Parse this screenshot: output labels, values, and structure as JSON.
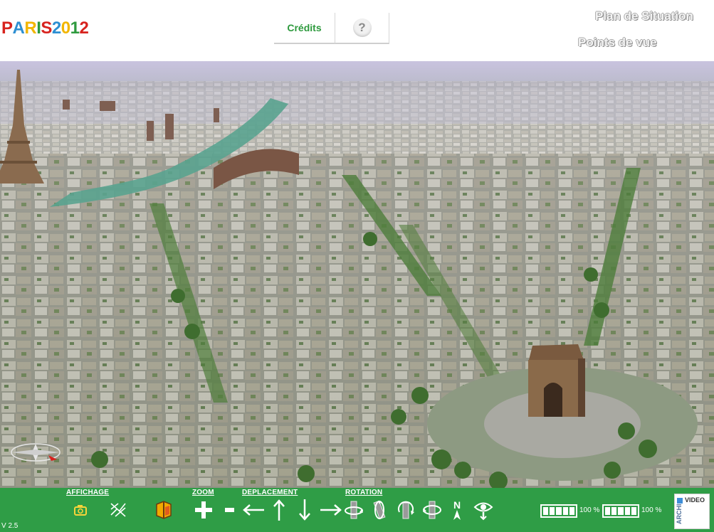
{
  "header": {
    "logo_text": "PARIS2012",
    "tabs": [
      {
        "label": "Crédits"
      },
      {
        "label": "?"
      }
    ],
    "links": {
      "plan": "Plan de Situation",
      "points": "Points de vue"
    }
  },
  "toolbar": {
    "sections": {
      "affichage": "AFFICHAGE",
      "zoom": "ZOOM",
      "deplacement": "DEPLACEMENT",
      "rotation": "ROTATION"
    },
    "tools": {
      "affichage": [
        "camera-icon",
        "wireframe-icon",
        "book-icon"
      ],
      "zoom": [
        "plus-icon",
        "minus-icon"
      ],
      "deplacement": [
        "arrow-left-icon",
        "arrow-up-icon",
        "arrow-down-icon",
        "arrow-right-icon"
      ],
      "rotation": [
        "rotate-horizontal-icon",
        "rotate-tilt-icon",
        "rotate-around-icon",
        "rotate-vertical-icon",
        "north-icon",
        "eye-icon"
      ]
    },
    "north_letter": "N",
    "gauges": [
      {
        "value": "100 %",
        "fraction": 1.0
      },
      {
        "value": "100 %",
        "fraction": 1.0
      }
    ],
    "version": "V 2.5",
    "archi_badge": {
      "video": "VIDEO",
      "archi": "ARCHI"
    }
  },
  "colors": {
    "toolbar_green": "#2f9d46",
    "credits_green": "#2e9a3e",
    "logo": [
      "#d7231e",
      "#2d8fd2",
      "#f2b600",
      "#2e9a3e",
      "#d7231e",
      "#2d8fd2",
      "#f2b600",
      "#2e9a3e",
      "#d7231e"
    ]
  }
}
